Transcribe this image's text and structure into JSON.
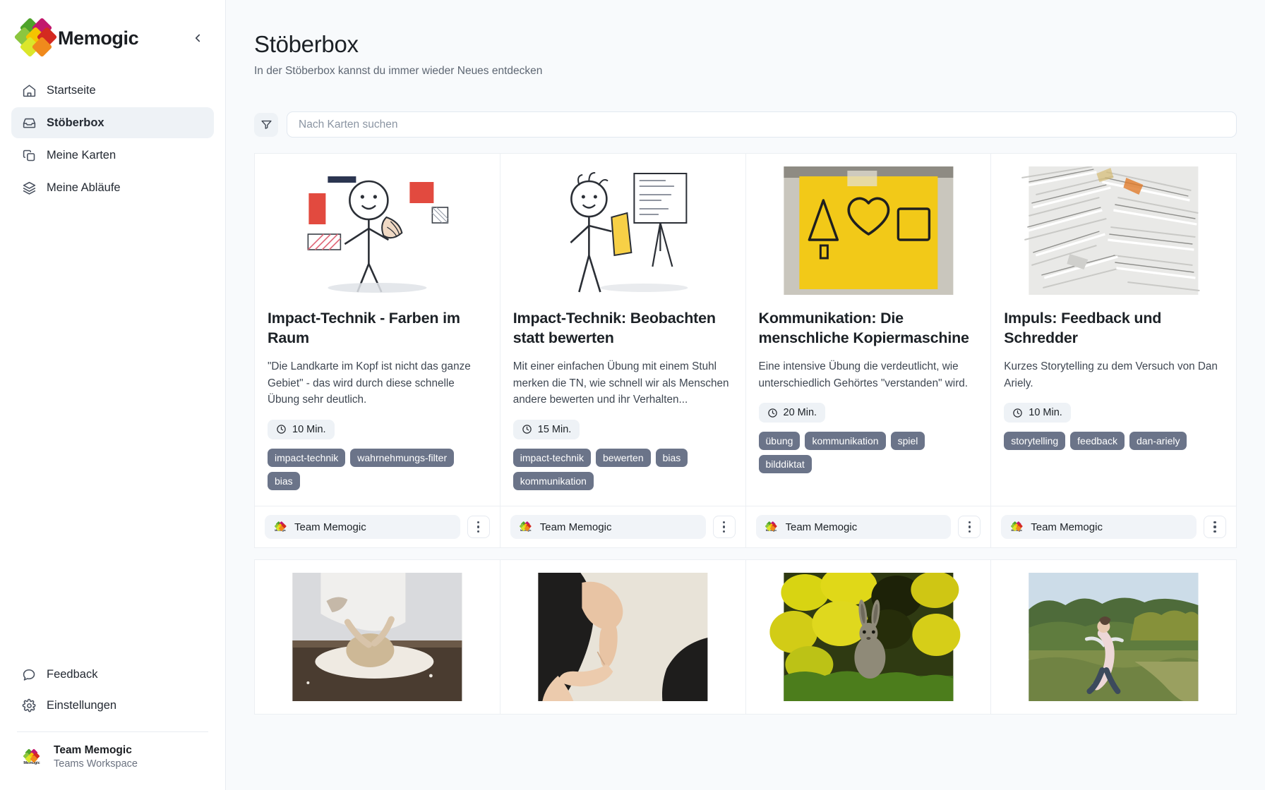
{
  "brand": {
    "name": "Memogic",
    "collapse_icon": "chevron-left-icon"
  },
  "sidebar": {
    "items": [
      {
        "label": "Startseite",
        "icon": "home-icon",
        "active": false
      },
      {
        "label": "Stöberbox",
        "icon": "inbox-icon",
        "active": true
      },
      {
        "label": "Meine Karten",
        "icon": "copy-icon",
        "active": false
      },
      {
        "label": "Meine Abläufe",
        "icon": "layers-icon",
        "active": false
      }
    ],
    "bottom_items": [
      {
        "label": "Feedback",
        "icon": "chat-bubble-icon"
      },
      {
        "label": "Einstellungen",
        "icon": "gear-icon"
      }
    ],
    "workspace": {
      "name": "Team Memogic",
      "subtitle": "Teams Workspace",
      "avatar_label": "Memogic"
    }
  },
  "header": {
    "title": "Stöberbox",
    "subtitle": "In der Stöberbox kannst du immer wieder Neues entdecken"
  },
  "search": {
    "placeholder": "Nach Karten suchen",
    "value": "",
    "filter_icon": "funnel-icon"
  },
  "colors": {
    "logo_green": "#4ea32a",
    "logo_magenta": "#c2186d",
    "logo_lightgreen": "#8cc63f",
    "logo_yellow": "#f5c400",
    "logo_red": "#d42a20",
    "logo_yellowgreen": "#dbe62a",
    "logo_orange": "#f08a1c",
    "tag_bg": "#6b7489",
    "active_nav_bg": "#eef2f6",
    "page_bg": "#f8fafc",
    "card_bg": "#ffffff"
  },
  "cards": [
    {
      "title": "Impact-Technik - Farben im Raum",
      "description": "\"Die Landkarte im Kopf ist nicht das ganze Gebiet\" - das wird durch diese schnelle Übung sehr deutlich.",
      "duration": "10 Min.",
      "tags": [
        "impact-technik",
        "wahrnehmungs-filter",
        "bias"
      ],
      "owner": "Team Memogic",
      "thumb": "illustration-person-flags",
      "menu_icon": "kebab-menu-icon"
    },
    {
      "title": "Impact-Technik: Beobachten statt bewerten",
      "description": "Mit einer einfachen Übung mit einem Stuhl merken die TN, wie schnell wir als Menschen andere bewerten und ihr Verhalten...",
      "duration": "15 Min.",
      "tags": [
        "impact-technik",
        "bewerten",
        "bias",
        "kommunikation"
      ],
      "owner": "Team Memogic",
      "thumb": "illustration-person-flipchart",
      "menu_icon": "kebab-menu-icon"
    },
    {
      "title": "Kommunikation: Die menschliche Kopiermaschine",
      "description": "Eine intensive Übung die verdeutlicht, wie unterschiedlich Gehörtes \"verstanden\" wird.",
      "duration": "20 Min.",
      "tags": [
        "übung",
        "kommunikation",
        "spiel",
        "bilddiktat"
      ],
      "owner": "Team Memogic",
      "thumb": "photo-yellow-sticky-note",
      "menu_icon": "kebab-menu-icon"
    },
    {
      "title": "Impuls: Feedback und Schredder",
      "description": "Kurzes Storytelling zu dem Versuch von Dan Ariely.",
      "duration": "10 Min.",
      "tags": [
        "storytelling",
        "feedback",
        "dan-ariely"
      ],
      "owner": "Team Memogic",
      "thumb": "photo-shredded-paper",
      "menu_icon": "kebab-menu-icon"
    }
  ],
  "cards_row2": [
    {
      "thumb": "photo-kneading-dough"
    },
    {
      "thumb": "photo-hands-pointing"
    },
    {
      "thumb": "photo-rabbit-field"
    },
    {
      "thumb": "photo-jumping-person"
    }
  ]
}
